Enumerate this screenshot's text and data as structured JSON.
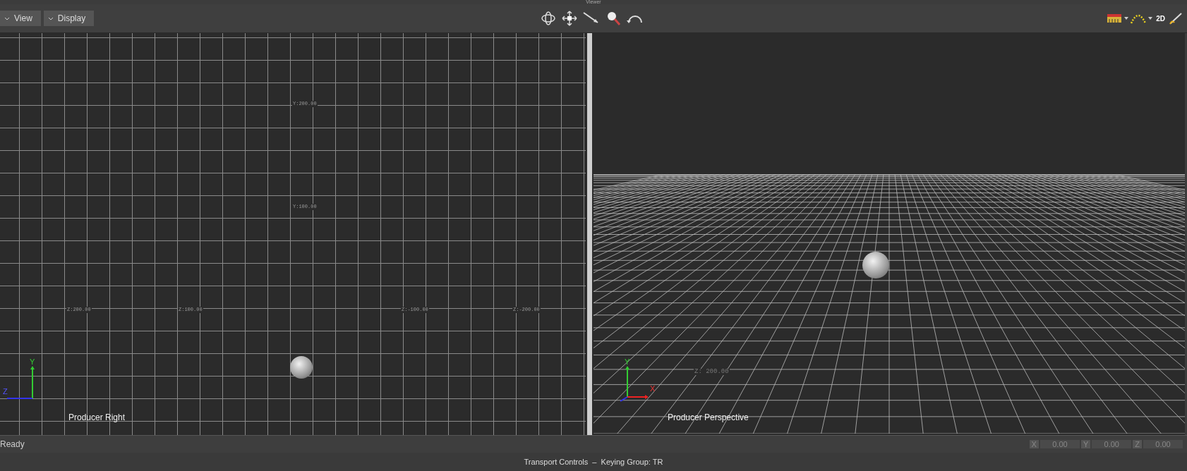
{
  "window": {
    "title": "Viewer"
  },
  "toolbar": {
    "menus": [
      {
        "label": "View"
      },
      {
        "label": "Display"
      }
    ],
    "badge_2d": "2D"
  },
  "left_viewport": {
    "name": "Producer Right",
    "labels": [
      "Y:200.00",
      "Y:100.00",
      "Z:200.00",
      "Z:100.00",
      "Z:-100.00",
      "Z:-200.00"
    ],
    "axes": {
      "vertical": "Y",
      "horizontal": "Z"
    }
  },
  "right_viewport": {
    "name": "Producer Perspective",
    "labels": [
      "Z: 200.00"
    ],
    "axes": {
      "vertical": "Y",
      "horizontal": "X"
    }
  },
  "status_bar": {
    "message": "Ready",
    "coords": [
      {
        "axis": "X",
        "value": "0.00"
      },
      {
        "axis": "Y",
        "value": "0.00"
      },
      {
        "axis": "Z",
        "value": "0.00"
      }
    ]
  },
  "footer": {
    "text": "Transport Controls  –  Keying Group: TR"
  }
}
